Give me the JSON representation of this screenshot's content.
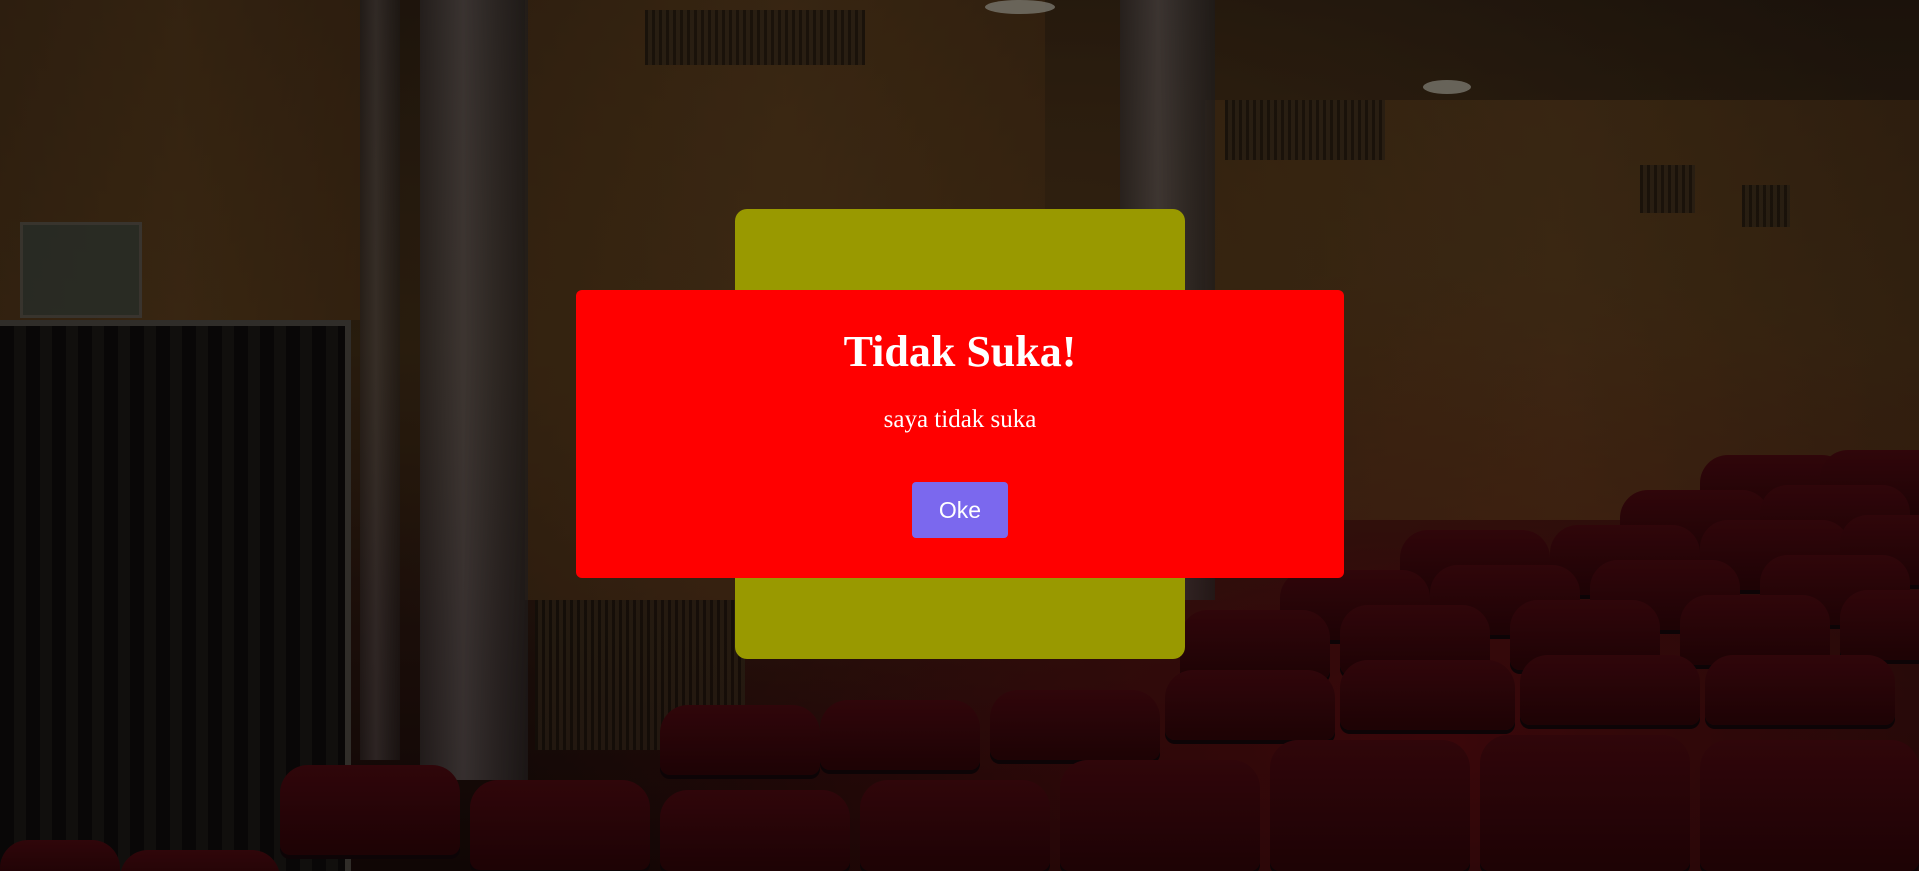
{
  "dialog": {
    "title": "Tidak Suka!",
    "message": "saya tidak suka",
    "ok_label": "Oke"
  },
  "colors": {
    "back_card": "#999900",
    "dialog_background": "#ff0000",
    "ok_button": "#7b68ee",
    "text": "#ffffff"
  }
}
